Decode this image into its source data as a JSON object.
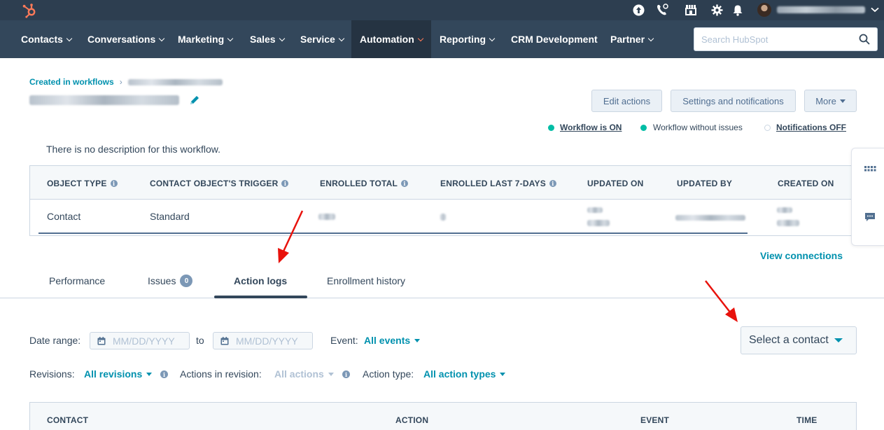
{
  "nav": {
    "items": [
      {
        "label": "Contacts"
      },
      {
        "label": "Conversations"
      },
      {
        "label": "Marketing"
      },
      {
        "label": "Sales"
      },
      {
        "label": "Service"
      },
      {
        "label": "Automation"
      },
      {
        "label": "Reporting"
      },
      {
        "label": "CRM Development"
      },
      {
        "label": "Partner"
      }
    ],
    "active": "Automation",
    "search_placeholder": "Search HubSpot"
  },
  "topbar_icons": [
    "upgrade-icon",
    "calling-icon",
    "marketplace-icon",
    "settings-icon",
    "notifications-icon"
  ],
  "breadcrumb": {
    "parent": "Created in workflows"
  },
  "header": {
    "edit_actions": "Edit actions",
    "settings_notifications": "Settings and notifications",
    "more": "More"
  },
  "status": {
    "workflow_on": "Workflow is ON",
    "without_issues": "Workflow without issues",
    "notifications_off": "Notifications OFF"
  },
  "description": "There is no description for this workflow.",
  "summary": {
    "headers": {
      "object_type": "OBJECT TYPE",
      "trigger": "CONTACT OBJECT'S TRIGGER",
      "enrolled_total": "ENROLLED TOTAL",
      "enrolled_7": "ENROLLED LAST 7-DAYS",
      "updated_on": "UPDATED ON",
      "updated_by": "UPDATED BY",
      "created_on": "CREATED ON"
    },
    "values": {
      "object_type": "Contact",
      "trigger": "Standard"
    }
  },
  "view_connections": "View connections",
  "tabs": {
    "performance": "Performance",
    "issues": "Issues",
    "issues_count": "0",
    "action_logs": "Action logs",
    "enrollment_history": "Enrollment history"
  },
  "filters": {
    "date_range_label": "Date range:",
    "date_placeholder": "MM/DD/YYYY",
    "to_label": "to",
    "event_label": "Event:",
    "event_value": "All events",
    "revisions_label": "Revisions:",
    "revisions_value": "All revisions",
    "actions_in_revision_label": "Actions in revision:",
    "actions_in_revision_value": "All actions",
    "action_type_label": "Action type:",
    "action_type_value": "All action types",
    "select_contact": "Select a contact"
  },
  "logs_table": {
    "headers": {
      "contact": "CONTACT",
      "action": "ACTION",
      "event": "EVENT",
      "time": "TIME"
    }
  },
  "colors": {
    "nav_bg": "#33475b",
    "topbar_bg": "#2d3e50",
    "link": "#0091ae",
    "status_on": "#00bda5",
    "hubspot_orange": "#ff7a59",
    "annotation_arrow": "#e8120c"
  }
}
